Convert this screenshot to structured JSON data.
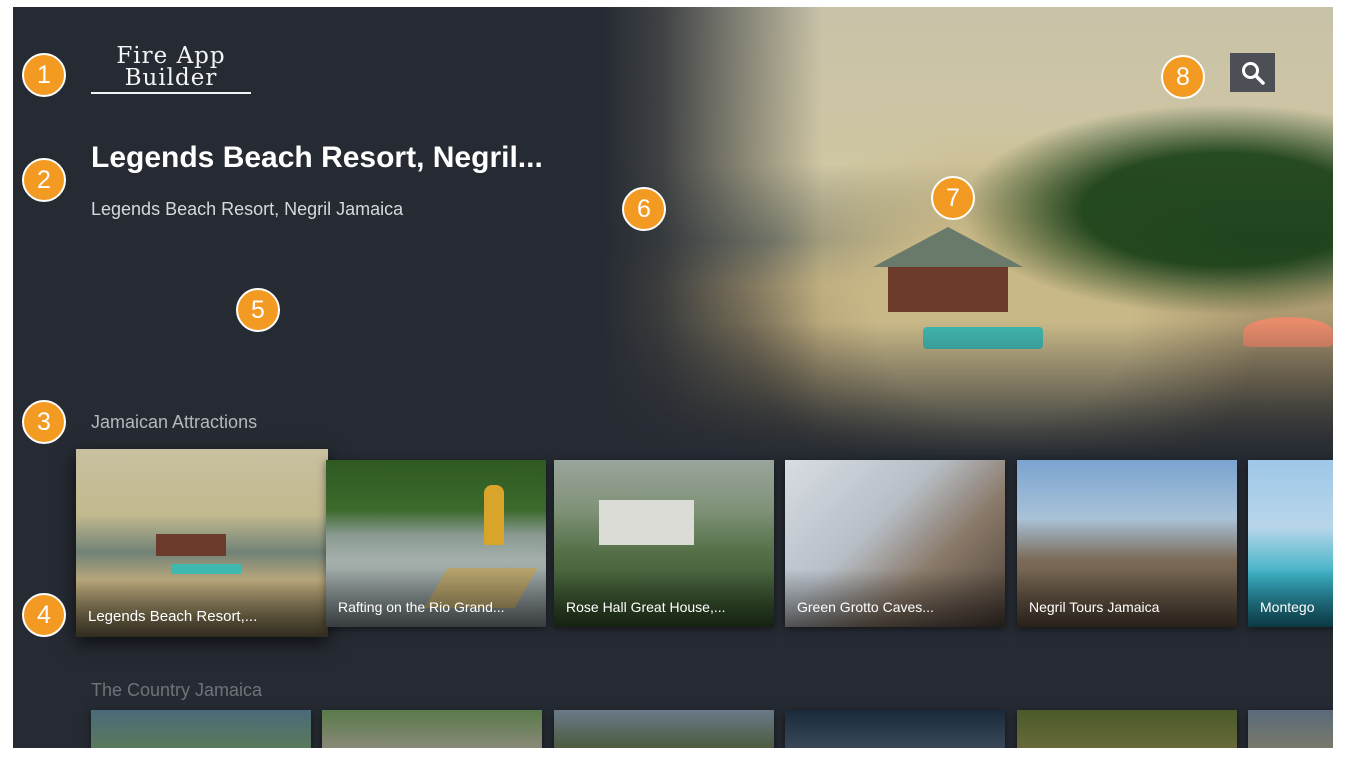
{
  "app": {
    "logo_line1": "Fire App",
    "logo_line2": "Builder"
  },
  "header": {
    "title": "Legends Beach Resort, Negril...",
    "subtitle": "Legends Beach Resort, Negril Jamaica",
    "search_icon": "search-icon"
  },
  "rows": [
    {
      "title": "Jamaican Attractions",
      "cards": [
        {
          "label": "Legends Beach Resort,..."
        },
        {
          "label": "Rafting on the Rio Grand..."
        },
        {
          "label": "Rose Hall Great House,..."
        },
        {
          "label": "Green Grotto Caves..."
        },
        {
          "label": "Negril Tours Jamaica"
        },
        {
          "label": "Montego"
        }
      ]
    },
    {
      "title": "The Country Jamaica",
      "cards": []
    }
  ],
  "markers": [
    "1",
    "2",
    "3",
    "4",
    "5",
    "6",
    "7",
    "8"
  ],
  "colors": {
    "background": "#262b33",
    "marker": "#f39a22",
    "search_button": "#4c4f55"
  }
}
